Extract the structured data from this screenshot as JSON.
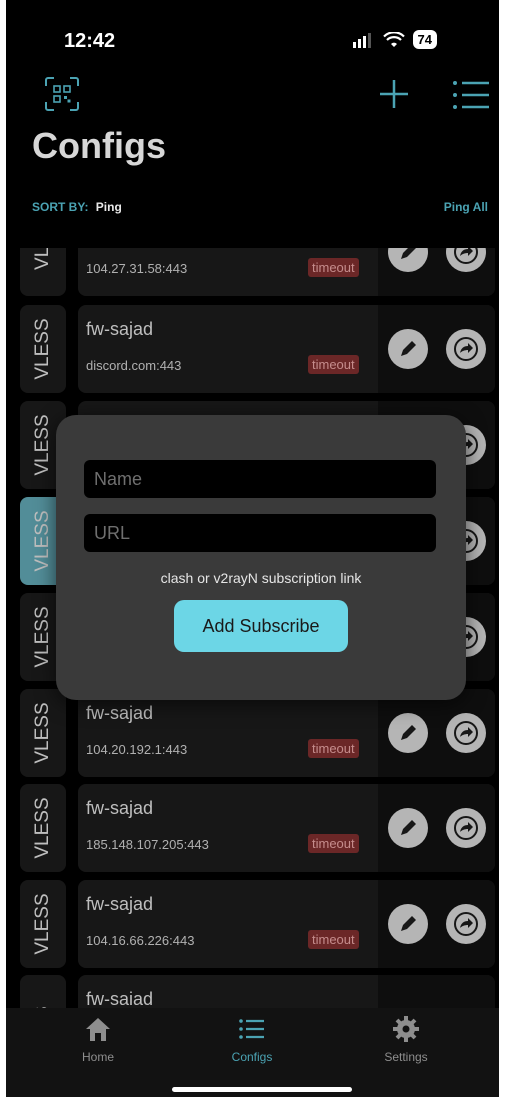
{
  "status": {
    "time": "12:42",
    "battery": "74"
  },
  "header": {
    "title": "Configs"
  },
  "sort": {
    "label": "SORT BY:",
    "value": "Ping",
    "ping_all": "Ping All"
  },
  "configs": [
    {
      "type": "VLE",
      "name": "",
      "address": "104.27.31.58:443",
      "status": "timeout"
    },
    {
      "type": "VLESS",
      "name": "fw-sajad",
      "address": "discord.com:443",
      "status": "timeout"
    },
    {
      "type": "VLESS",
      "name": "",
      "address": "",
      "status": ""
    },
    {
      "type": "VLESS",
      "name": "",
      "address": "",
      "status": ""
    },
    {
      "type": "VLESS",
      "name": "",
      "address": "",
      "status": ""
    },
    {
      "type": "VLESS",
      "name": "fw-sajad",
      "address": "104.20.192.1:443",
      "status": "timeout"
    },
    {
      "type": "VLESS",
      "name": "fw-sajad",
      "address": "185.148.107.205:443",
      "status": "timeout"
    },
    {
      "type": "VLESS",
      "name": "fw-sajad",
      "address": "104.16.66.226:443",
      "status": "timeout"
    },
    {
      "type": "SS",
      "name": "fw-saiad",
      "address": "",
      "status": ""
    }
  ],
  "modal": {
    "name_placeholder": "Name",
    "url_placeholder": "URL",
    "help": "clash or v2rayN subscription link",
    "button": "Add Subscribe"
  },
  "tabs": [
    {
      "label": "Home",
      "icon": "home-icon"
    },
    {
      "label": "Configs",
      "icon": "list-icon"
    },
    {
      "label": "Settings",
      "icon": "gear-icon"
    }
  ],
  "colors": {
    "accent": "#4ba3b3",
    "button": "#6cd6e6",
    "timeout": "#7a2d2d"
  }
}
